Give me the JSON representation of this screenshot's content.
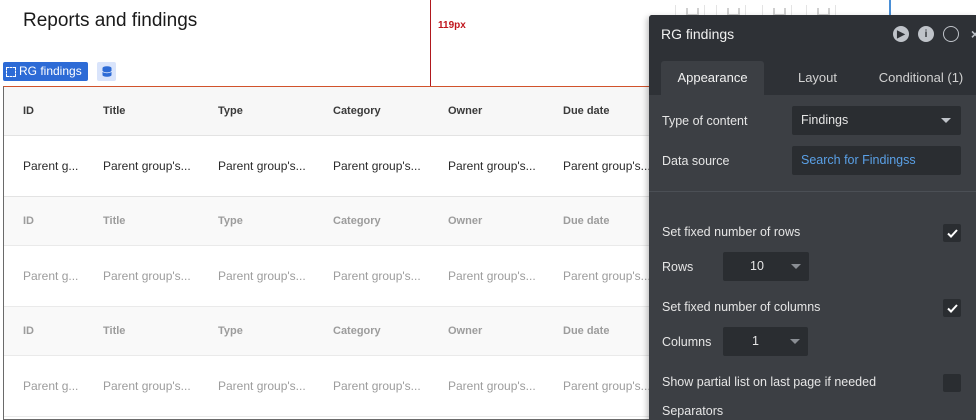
{
  "canvas": {
    "page_title": "Reports and findings",
    "guide_label": "119px",
    "rg_tag_label": "RG findings"
  },
  "table": {
    "columns": [
      "ID",
      "Title",
      "Type",
      "Category",
      "Owner",
      "Due date"
    ],
    "rows": [
      [
        "Parent g...",
        "Parent group's...",
        "Parent group's...",
        "Parent group's...",
        "Parent group's...",
        "Parent group's..."
      ],
      [
        "Parent g...",
        "Parent group's...",
        "Parent group's...",
        "Parent group's...",
        "Parent group's...",
        "Parent group's..."
      ],
      [
        "Parent g...",
        "Parent group's...",
        "Parent group's...",
        "Parent group's...",
        "Parent group's...",
        "Parent group's..."
      ]
    ]
  },
  "panel": {
    "title": "RG findings",
    "tabs": [
      "Appearance",
      "Layout",
      "Conditional (1)"
    ],
    "active_tab": "Appearance",
    "type_of_content_label": "Type of content",
    "type_of_content_value": "Findings",
    "data_source_label": "Data source",
    "data_source_value": "Search for Findingss",
    "fixed_rows_label": "Set fixed number of rows",
    "fixed_rows_checked": true,
    "rows_label": "Rows",
    "rows_value": "10",
    "fixed_columns_label": "Set fixed number of columns",
    "fixed_columns_checked": true,
    "columns_label": "Columns",
    "columns_value": "1",
    "partial_list_label": "Show partial list on last page if needed",
    "partial_list_checked": false,
    "separators_label": "Separators"
  },
  "colors": {
    "panel_bg": "#3c3f44",
    "panel_header": "#2e3136",
    "selection_blue": "#2d6bd6",
    "guide_red": "#c0161d",
    "data_source_blue": "#5aa0e6"
  }
}
